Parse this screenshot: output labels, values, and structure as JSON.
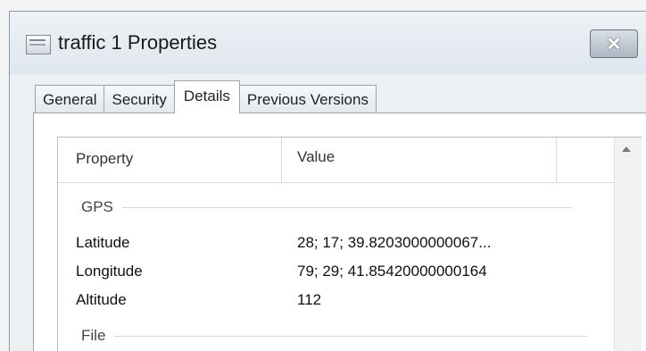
{
  "window": {
    "title": "traffic 1 Properties",
    "close_label": "✕"
  },
  "tabs": [
    {
      "label": "General",
      "active": false
    },
    {
      "label": "Security",
      "active": false
    },
    {
      "label": "Details",
      "active": true
    },
    {
      "label": "Previous Versions",
      "active": false
    }
  ],
  "details": {
    "columns": {
      "property": "Property",
      "value": "Value"
    },
    "groups": [
      {
        "name": "GPS",
        "rows": [
          {
            "property": "Latitude",
            "value": "28; 17; 39.8203000000067..."
          },
          {
            "property": "Longitude",
            "value": "79; 29; 41.85420000000164"
          },
          {
            "property": "Altitude",
            "value": "112"
          }
        ]
      },
      {
        "name": "File",
        "rows": []
      }
    ]
  }
}
